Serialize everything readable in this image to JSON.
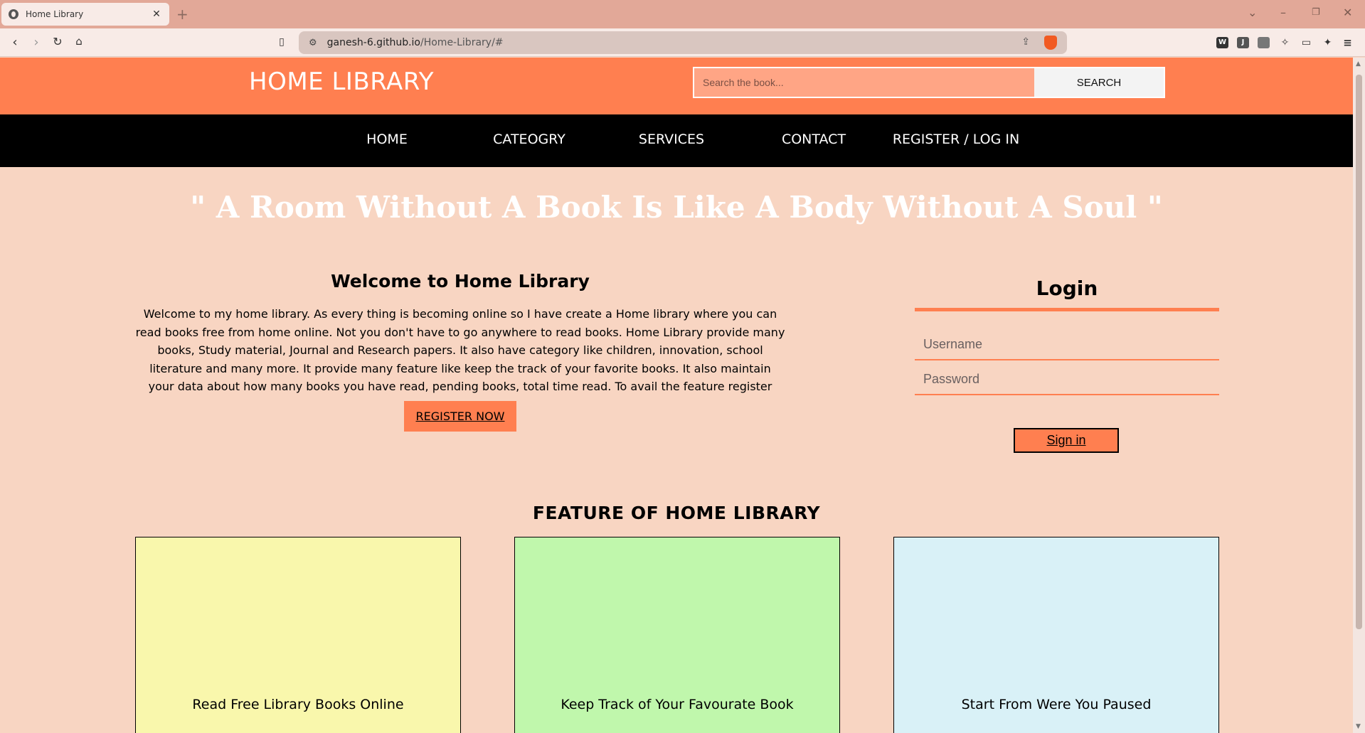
{
  "browser": {
    "tab_title": "Home Library",
    "tab_close": "✕",
    "new_tab": "+",
    "url_host": "ganesh-6.github.io",
    "url_path": "/Home-Library/#",
    "extensions": [
      "W",
      "J",
      "",
      "",
      "",
      ""
    ]
  },
  "header": {
    "logo": "HOME LIBRARY",
    "search_placeholder": "Search the book...",
    "search_button": "SEARCH"
  },
  "nav": {
    "items": [
      "HOME",
      "CATEOGRY",
      "SERVICES",
      "CONTACT",
      "REGISTER / LOG IN"
    ]
  },
  "quote": "\" A Room Without A Book Is Like A Body Without A Soul \"",
  "welcome": {
    "title": "Welcome to Home Library",
    "text": "Welcome to my home library. As every thing is becoming online so I have create a Home library where you can read books free from home online. Not you don't have to go anywhere to read books. Home Library provide many books, Study material, Journal and Research papers. It also have category like children, innovation, school literature and many more. It provide many feature like keep the track of your favorite books. It also maintain your data about how many books you have read, pending books, total time read. To avail the feature register now.",
    "register_button": "REGISTER NOW"
  },
  "login": {
    "title": "Login",
    "username_placeholder": "Username",
    "password_placeholder": "Password",
    "signin_button": "Sign in"
  },
  "features": {
    "title": "FEATURE OF HOME LIBRARY",
    "cards": [
      {
        "label": "Read Free Library Books Online",
        "color": "#f9f7ac"
      },
      {
        "label": "Keep Track of Your Favourate Book",
        "color": "#c0f7ac"
      },
      {
        "label": "Start From Were You Paused",
        "color": "#d9f1f7"
      }
    ]
  },
  "colors": {
    "accent": "#ff7f50",
    "page_background": "#f8d5c2",
    "nav_background": "#000000"
  }
}
